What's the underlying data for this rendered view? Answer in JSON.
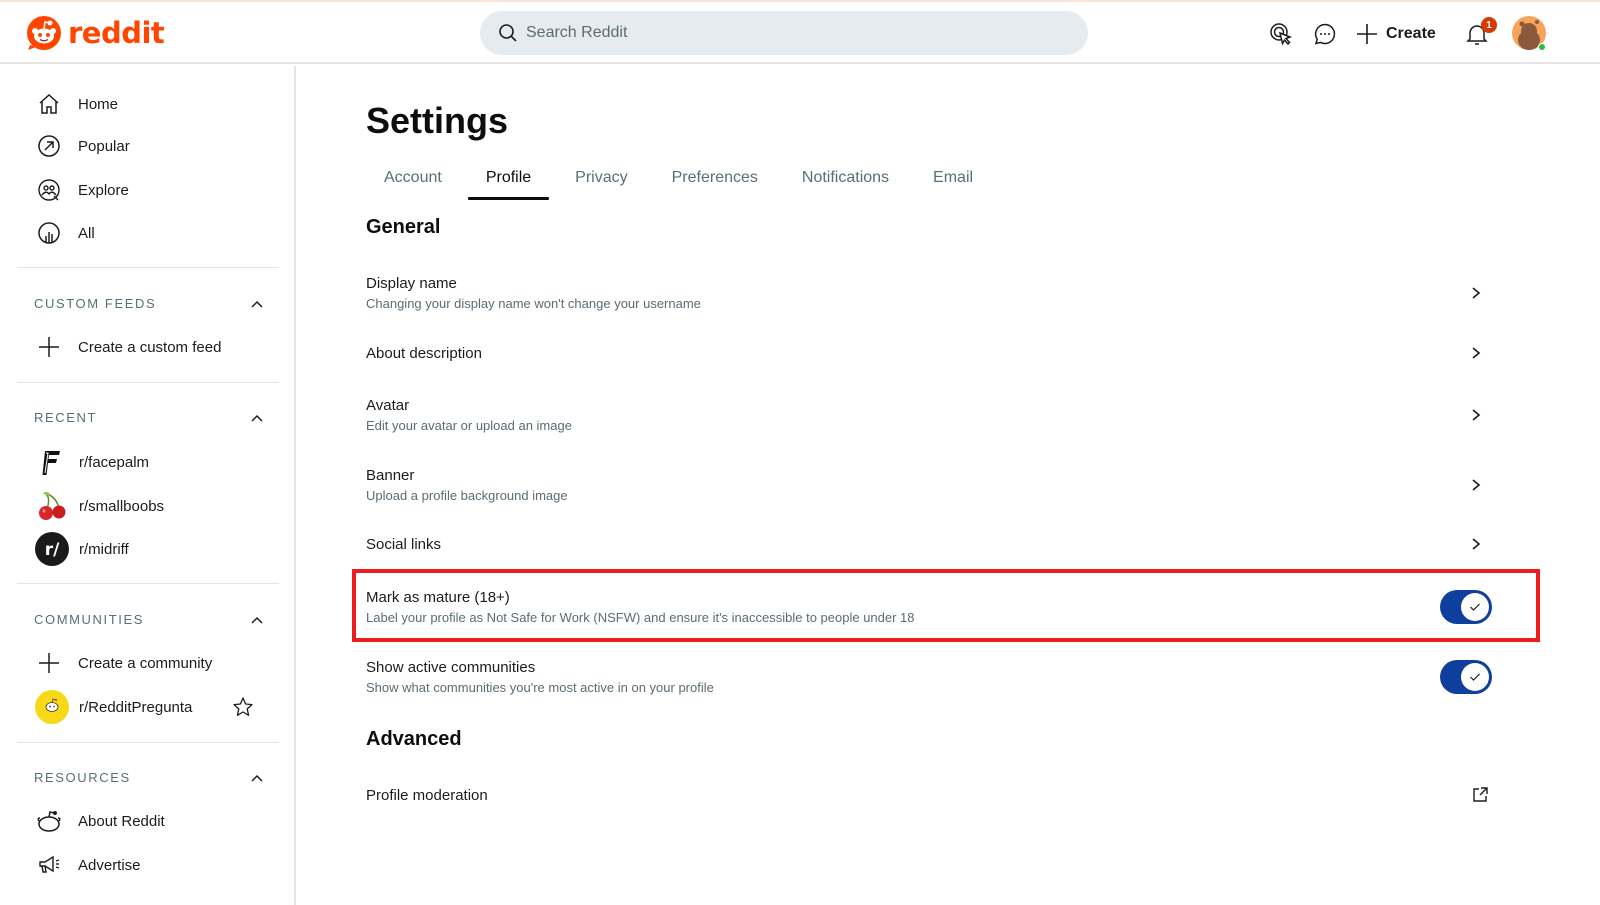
{
  "header": {
    "logo_text": "reddit",
    "search_placeholder": "Search Reddit",
    "create_label": "Create",
    "notification_count": "1",
    "brand_color": "#ff4500"
  },
  "sidebar": {
    "main_nav": [
      {
        "label": "Home",
        "icon": "home-icon"
      },
      {
        "label": "Popular",
        "icon": "popular-icon"
      },
      {
        "label": "Explore",
        "icon": "explore-icon"
      },
      {
        "label": "All",
        "icon": "all-icon"
      }
    ],
    "sections": [
      {
        "title": "CUSTOM FEEDS",
        "items": [
          {
            "label": "Create a custom feed",
            "icon": "plus-icon"
          }
        ]
      },
      {
        "title": "RECENT",
        "items": [
          {
            "label": "r/facepalm",
            "icon": "facepalm-community-icon"
          },
          {
            "label": "r/smallboobs",
            "icon": "cherry-community-icon"
          },
          {
            "label": "r/midriff",
            "icon": "midriff-community-icon"
          }
        ]
      },
      {
        "title": "COMMUNITIES",
        "items": [
          {
            "label": "Create a community",
            "icon": "plus-icon"
          },
          {
            "label": "r/RedditPregunta",
            "icon": "redditpregunta-community-icon",
            "favorite": false
          }
        ]
      },
      {
        "title": "RESOURCES",
        "items": [
          {
            "label": "About Reddit",
            "icon": "reddit-alien-icon"
          },
          {
            "label": "Advertise",
            "icon": "megaphone-icon"
          }
        ]
      }
    ]
  },
  "main": {
    "title": "Settings",
    "tabs": [
      {
        "label": "Account",
        "active": false
      },
      {
        "label": "Profile",
        "active": true
      },
      {
        "label": "Privacy",
        "active": false
      },
      {
        "label": "Preferences",
        "active": false
      },
      {
        "label": "Notifications",
        "active": false
      },
      {
        "label": "Email",
        "active": false
      }
    ],
    "general_title": "General",
    "general_rows": [
      {
        "label": "Display name",
        "description": "Changing your display name won't change your username",
        "control": "chevron"
      },
      {
        "label": "About description",
        "description": "",
        "control": "chevron"
      },
      {
        "label": "Avatar",
        "description": "Edit your avatar or upload an image",
        "control": "chevron"
      },
      {
        "label": "Banner",
        "description": "Upload a profile background image",
        "control": "chevron"
      },
      {
        "label": "Social links",
        "description": "",
        "control": "chevron"
      },
      {
        "label": "Mark as mature (18+)",
        "description": "Label your profile as Not Safe for Work (NSFW) and ensure it's inaccessible to people under 18",
        "control": "toggle",
        "checked": true,
        "highlighted": true
      },
      {
        "label": "Show active communities",
        "description": "Show what communities you're most active in on your profile",
        "control": "toggle",
        "checked": true
      }
    ],
    "advanced_title": "Advanced",
    "advanced_rows": [
      {
        "label": "Profile moderation",
        "control": "external-link"
      }
    ],
    "toggle_on_color": "#0f3f9c",
    "highlight_color": "#ee1c1c"
  }
}
